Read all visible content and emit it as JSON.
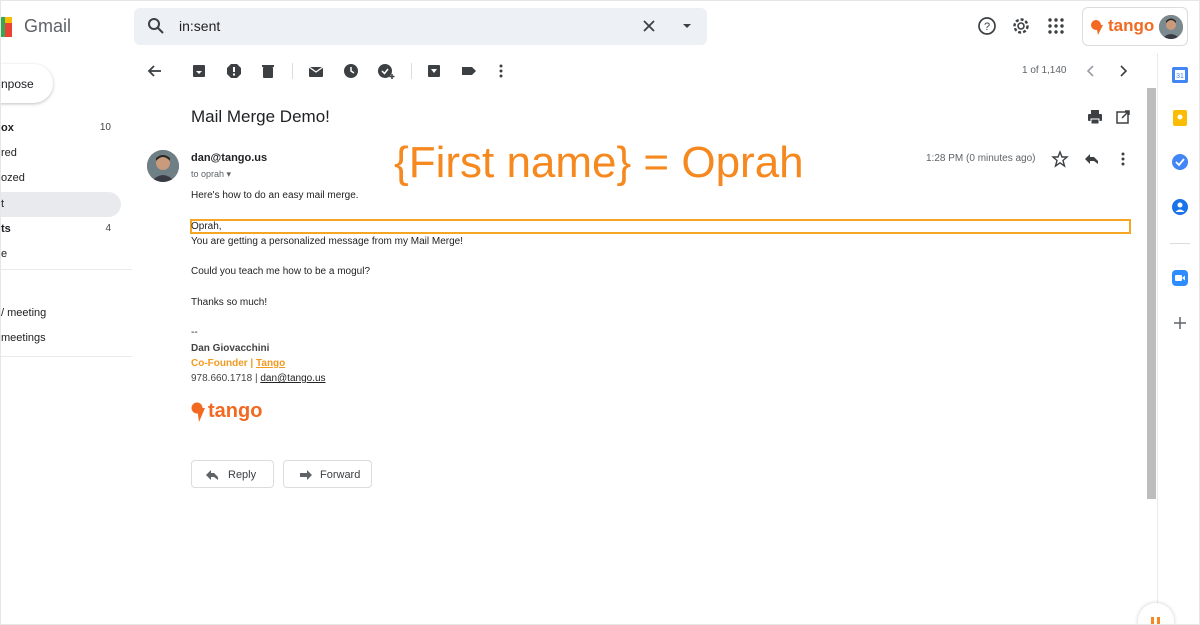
{
  "header": {
    "app_name": "Gmail",
    "search_query": "in:sent",
    "brand_extension": "tango"
  },
  "sidebar": {
    "compose_label": "npose",
    "items": [
      {
        "label": "ox",
        "count": "10",
        "bold": true
      },
      {
        "label": "red",
        "count": "",
        "bold": false
      },
      {
        "label": "ozed",
        "count": "",
        "bold": false
      },
      {
        "label": "t",
        "count": "",
        "bold": false,
        "active": true
      },
      {
        "label": "ts",
        "count": "4",
        "bold": true
      },
      {
        "label": "e",
        "count": "",
        "bold": false
      }
    ],
    "meet_items": [
      "/ meeting",
      "meetings"
    ]
  },
  "toolbar": {
    "pager": "1 of 1,140"
  },
  "message": {
    "subject": "Mail Merge Demo!",
    "sender": "dan@tango.us",
    "recipient": "to oprah",
    "time": "1:28 PM (0 minutes ago)",
    "body": [
      "Here's how to do an easy mail merge.",
      "Oprah,",
      "You are getting a personalized message from my Mail Merge!",
      "Could you teach me how to be a mogul?",
      "Thanks so much!",
      "--"
    ],
    "signature": {
      "name": "Dan Giovacchini",
      "title": "Co-Founder | ",
      "title_link": "Tango",
      "phone": "978.660.1718 | ",
      "email": "dan@tango.us",
      "logo_text": "tango"
    },
    "reply_label": "Reply",
    "forward_label": "Forward"
  },
  "annotation": "{First name} = Oprah",
  "colors": {
    "accent": "#f26a21",
    "annotation": "#f5891f",
    "highlight": "#f5a623"
  }
}
